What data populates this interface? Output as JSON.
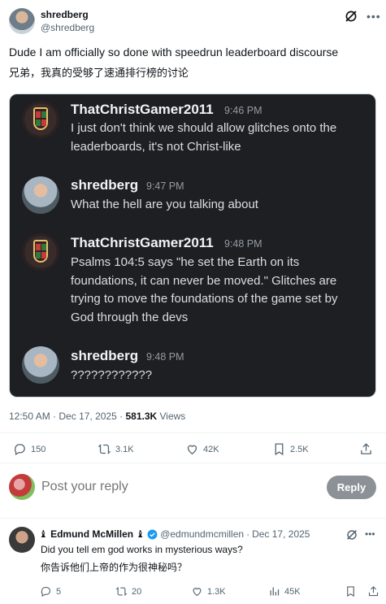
{
  "post": {
    "author_name": "shredberg",
    "author_handle": "@shredberg",
    "text": "Dude I am officially so done with speedrun leaderboard discourse",
    "text_translation": "兄弟，我真的受够了速通排行榜的讨论",
    "time": "12:50 AM",
    "date": "Dec 17, 2025",
    "views_count": "581.3K",
    "views_label": "Views",
    "separator": "·"
  },
  "chat": {
    "messages": [
      {
        "author": "ThatChristGamer2011",
        "time": "9:46 PM",
        "text": "I just don't think we should allow glitches onto the leaderboards, it's not Christ-like"
      },
      {
        "author": "shredberg",
        "time": "9:47 PM",
        "text": "What the hell are you talking about"
      },
      {
        "author": "ThatChristGamer2011",
        "time": "9:48 PM",
        "text": "Psalms 104:5 says \"he set the Earth on its foundations, it can never be moved.\" Glitches are trying to move the foundations of the game set by God through the devs"
      },
      {
        "author": "shredberg",
        "time": "9:48 PM",
        "text": "????????????"
      }
    ]
  },
  "actions": {
    "replies": "150",
    "reposts": "3.1K",
    "likes": "42K",
    "bookmarks": "2.5K"
  },
  "composer": {
    "placeholder": "Post your reply",
    "button_label": "Reply"
  },
  "reply": {
    "name": "♝ Edmund McMillen ♝",
    "handle": "@edmundmcmillen",
    "separator": "·",
    "date": "Dec 17, 2025",
    "text": "Did you tell em god works in mysterious ways?",
    "text_translation": "你告诉他们上帝的作为很神秘吗？",
    "replies": "5",
    "reposts": "20",
    "likes": "1.3K",
    "views": "45K"
  },
  "colors": {
    "text_primary": "#0f1419",
    "text_secondary": "#536471",
    "chat_bg": "#1e1f22",
    "verified": "#1d9bf0"
  },
  "icons": [
    "grok-icon",
    "more-icon",
    "reply-icon",
    "repost-icon",
    "like-icon",
    "bookmark-icon",
    "share-icon",
    "views-icon",
    "verified-icon"
  ]
}
